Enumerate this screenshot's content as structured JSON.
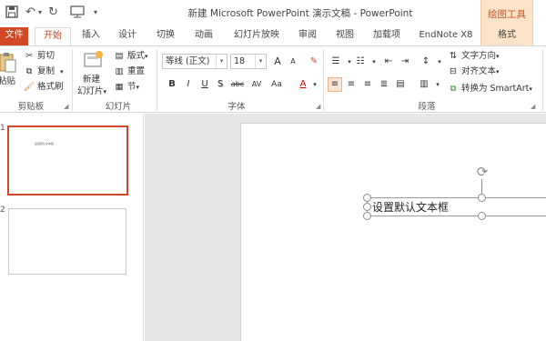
{
  "window": {
    "title": "新建 Microsoft PowerPoint 演示文稿 - PowerPoint",
    "context_label": "绘图工具"
  },
  "qat": {
    "save": "save-icon",
    "undo": "undo-icon",
    "redo": "redo-icon",
    "customize": "▾"
  },
  "tabs": [
    {
      "label": "文件"
    },
    {
      "label": "开始"
    },
    {
      "label": "插入"
    },
    {
      "label": "设计"
    },
    {
      "label": "切换"
    },
    {
      "label": "动画"
    },
    {
      "label": "幻灯片放映"
    },
    {
      "label": "审阅"
    },
    {
      "label": "视图"
    },
    {
      "label": "加载项"
    },
    {
      "label": "EndNote X8"
    },
    {
      "label": "格式"
    }
  ],
  "ribbon": {
    "clipboard": {
      "paste": "粘贴",
      "cut": "剪切",
      "copy": "复制",
      "painter": "格式刷",
      "label": "剪贴板"
    },
    "slides": {
      "new_slide": "新建",
      "new_slide2": "幻灯片",
      "layout": "版式",
      "reset": "重置",
      "section": "节",
      "label": "幻灯片"
    },
    "font": {
      "family": "等线 (正文)",
      "size": "18",
      "label": "字体",
      "buttons": {
        "bold": "B",
        "italic": "I",
        "underline": "U",
        "shadow": "S",
        "strike": "abc",
        "spacing": "AV",
        "case": "Aa",
        "color": "A",
        "grow": "A",
        "shrink": "A"
      }
    },
    "paragraph": {
      "label": "段落",
      "text_direction": "文字方向",
      "align_text": "对齐文本",
      "smartart": "转换为 SmartArt"
    }
  },
  "slides": [
    {
      "number": "1",
      "preview_text": "设置默认文本框"
    },
    {
      "number": "2"
    }
  ],
  "textbox": {
    "text": "设置默认文本框"
  }
}
